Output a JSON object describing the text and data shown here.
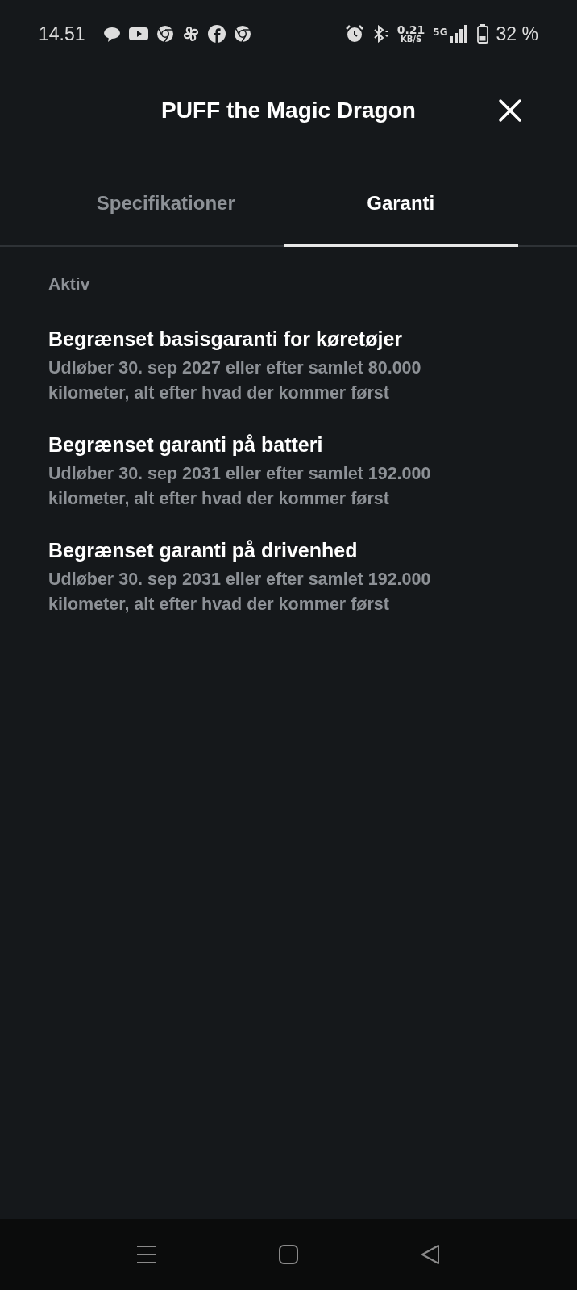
{
  "status_bar": {
    "time": "14.51",
    "network_speed": "0.21",
    "network_speed_unit": "KB/S",
    "network_type": "5G",
    "battery": "32 %"
  },
  "header": {
    "title": "PUFF the Magic Dragon"
  },
  "tabs": [
    {
      "label": "Specifikationer",
      "selected": false
    },
    {
      "label": "Garanti",
      "selected": true
    }
  ],
  "section": {
    "title": "Aktiv",
    "items": [
      {
        "title": "Begrænset basisgaranti for køretøjer",
        "description": "Udløber 30. sep 2027 eller efter samlet 80.000 kilometer, alt efter hvad der kommer først"
      },
      {
        "title": "Begrænset garanti på batteri",
        "description": "Udløber 30. sep 2031 eller efter samlet 192.000 kilometer, alt efter hvad der kommer først"
      },
      {
        "title": "Begrænset garanti på drivenhed",
        "description": "Udløber 30. sep 2031 eller efter samlet 192.000 kilometer, alt efter hvad der kommer først"
      }
    ]
  }
}
